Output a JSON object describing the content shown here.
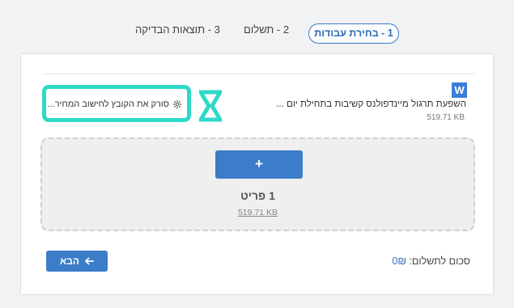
{
  "steps": [
    {
      "label": "1 - בחירת עבודות"
    },
    {
      "label": "2 - תשלום"
    },
    {
      "label": "3 - תוצאות הבדיקה"
    }
  ],
  "file": {
    "icon_letter": "W",
    "name": "השפעת תרגול מיינדפולנס קשיבות בתחילת יום ...",
    "size": "519.71 KB"
  },
  "scan": {
    "text": "סורק את הקובץ לחישוב המחיר...",
    "icon": "gear-icon"
  },
  "loader": {
    "icon": "hourglass-icon",
    "color": "#2fd9c8"
  },
  "drop_zone": {
    "add_label": "+",
    "item_count": "1 פריט",
    "total_size": "519.71 KB"
  },
  "footer": {
    "next_label": "הבא",
    "payment_label": "סכום לתשלום:",
    "payment_amount": "0₪"
  },
  "colors": {
    "accent": "#3b7dc9",
    "highlight": "#2fd9c8"
  }
}
